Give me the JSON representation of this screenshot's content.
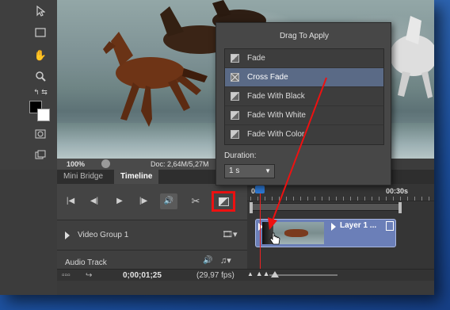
{
  "popup": {
    "title": "Drag To Apply",
    "items": [
      {
        "label": "Fade",
        "selected": false
      },
      {
        "label": "Cross Fade",
        "selected": true
      },
      {
        "label": "Fade With Black",
        "selected": false
      },
      {
        "label": "Fade With White",
        "selected": false
      },
      {
        "label": "Fade With Color",
        "selected": false
      }
    ],
    "duration_label": "Duration:",
    "duration_value": "1 s"
  },
  "status": {
    "zoom": "100%",
    "doc": "Doc: 2,64M/5,27M"
  },
  "panel": {
    "tabs": [
      "Mini Bridge",
      "Timeline"
    ],
    "active_tab": "Timeline",
    "tracks": [
      {
        "label": "Video Group 1"
      },
      {
        "label": "Audio Track"
      }
    ],
    "timecode": "0;00;01;25",
    "fps": "(29,97 fps)"
  },
  "timeline": {
    "ruler_start": "00",
    "ruler_end": "00:30s",
    "clip_label": "Layer 1 ..."
  },
  "colors": {
    "highlight_red": "#e11111",
    "clip_blue": "#6b7fb8",
    "playhead_blue": "#2d78d4",
    "selection": "#5a6a86"
  }
}
